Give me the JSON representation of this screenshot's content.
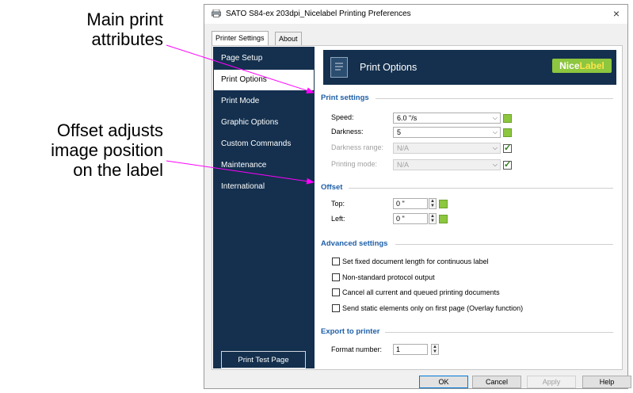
{
  "annotations": {
    "main_print_line1": "Main print",
    "main_print_line2": "attributes",
    "offset_line1": "Offset adjusts",
    "offset_line2": "image position",
    "offset_line3": "on the label",
    "arrow_color": "#ff00ff"
  },
  "window": {
    "title": "SATO S84-ex 203dpi_Nicelabel Printing Preferences",
    "close_glyph": "×"
  },
  "tabs": [
    {
      "label": "Printer Settings",
      "active": true
    },
    {
      "label": "About",
      "active": false
    }
  ],
  "sidebar": {
    "items": [
      {
        "label": "Page Setup"
      },
      {
        "label": "Print Options",
        "active": true
      },
      {
        "label": "Print Mode"
      },
      {
        "label": "Graphic Options"
      },
      {
        "label": "Custom Commands"
      },
      {
        "label": "Maintenance"
      },
      {
        "label": "International"
      }
    ],
    "test_button": "Print Test Page",
    "bg_color": "#14304e"
  },
  "header": {
    "title": "Print Options",
    "logo_nice": "Nice",
    "logo_label": "Label",
    "logo_color": "#8dc63f"
  },
  "print_settings": {
    "heading": "Print settings",
    "speed": {
      "label": "Speed:",
      "value": "6.0 \"/s"
    },
    "darkness": {
      "label": "Darkness:",
      "value": "5"
    },
    "darkness_range": {
      "label": "Darkness range:",
      "value": "N/A"
    },
    "printing_mode": {
      "label": "Printing mode:",
      "value": "N/A"
    }
  },
  "offset": {
    "heading": "Offset",
    "top": {
      "label": "Top:",
      "value": "0 \""
    },
    "left": {
      "label": "Left:",
      "value": "0 \""
    }
  },
  "advanced": {
    "heading": "Advanced settings",
    "options": [
      {
        "label": "Set fixed document length for continuous label"
      },
      {
        "label": "Non-standard protocol output"
      },
      {
        "label": "Cancel all current and queued printing documents"
      },
      {
        "label": "Send static elements only on first page (Overlay function)"
      }
    ]
  },
  "export": {
    "heading": "Export to printer",
    "format": {
      "label": "Format number:",
      "value": "1"
    }
  },
  "buttons": {
    "ok": "OK",
    "cancel": "Cancel",
    "apply": "Apply",
    "help": "Help"
  }
}
